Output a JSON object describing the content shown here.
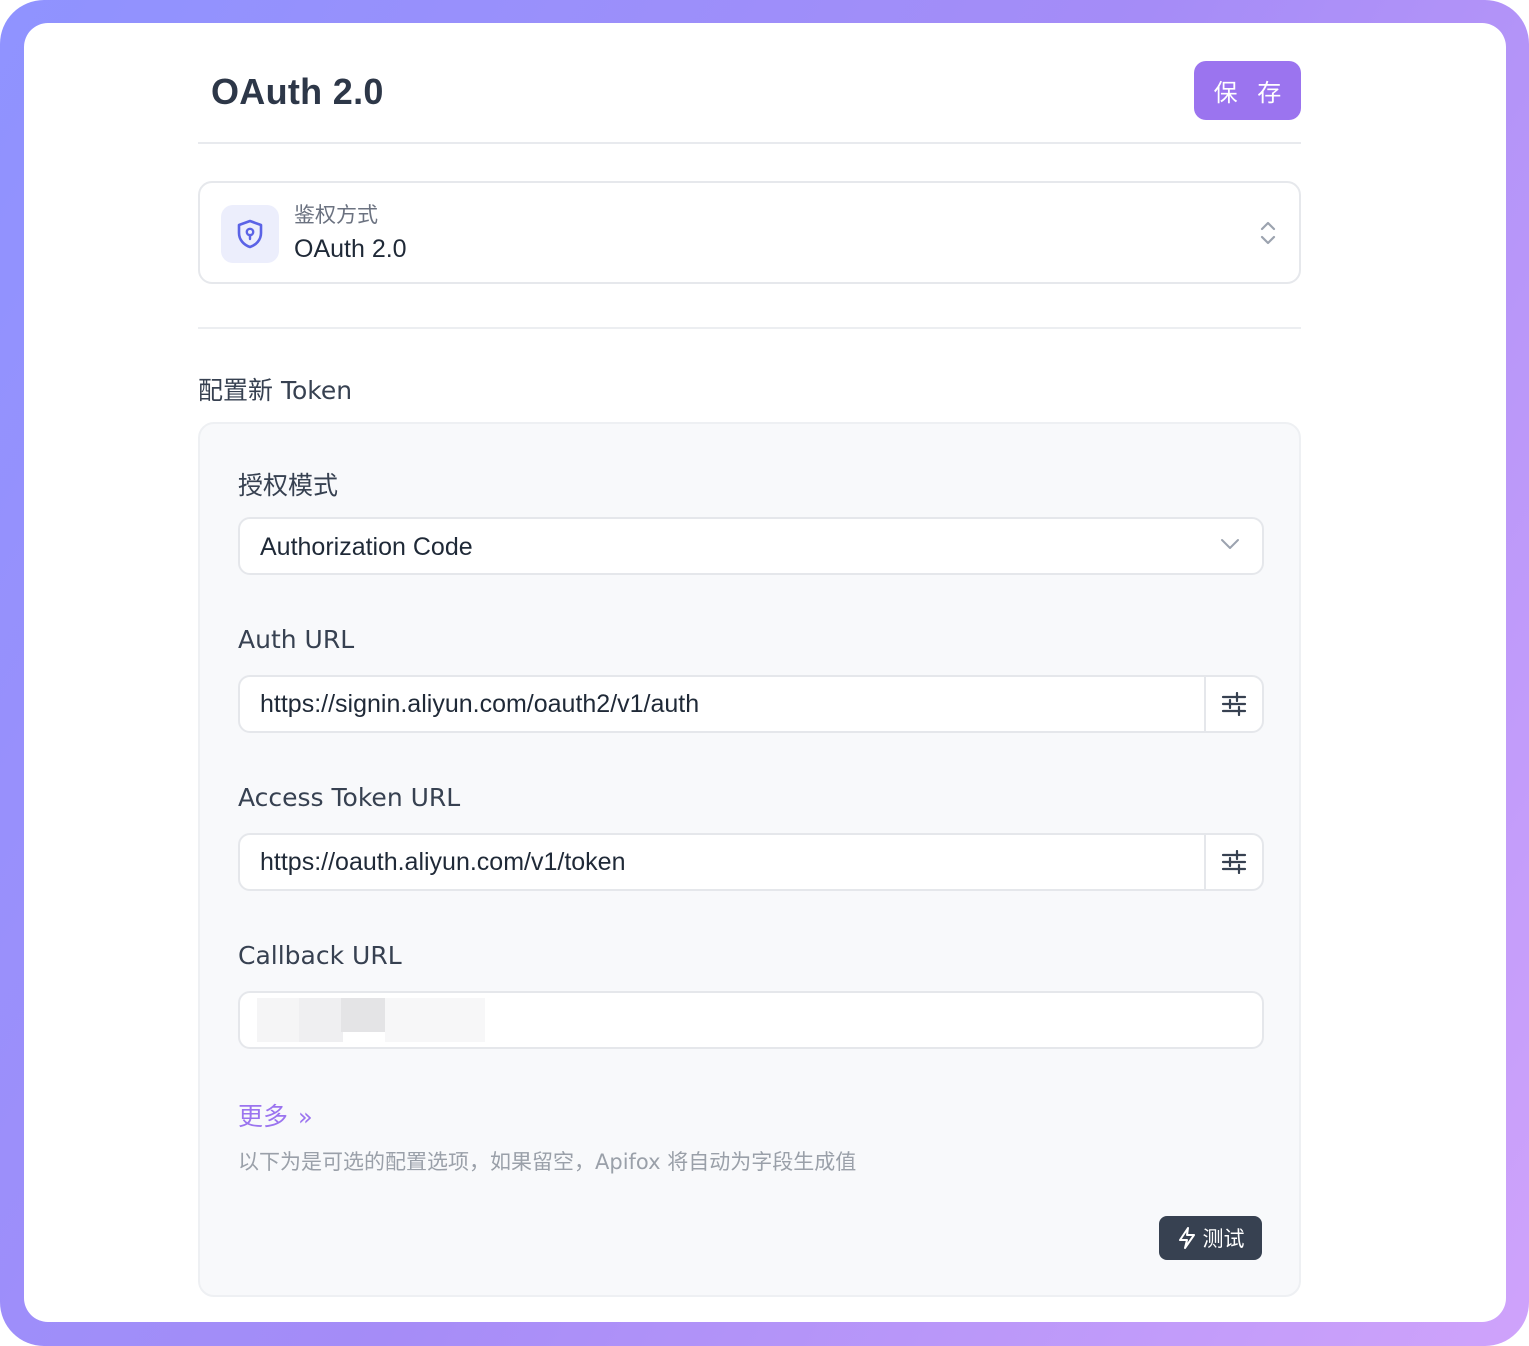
{
  "header": {
    "title": "OAuth 2.0",
    "save_label": "保 存"
  },
  "auth_method": {
    "label": "鉴权方式",
    "value": "OAuth 2.0"
  },
  "token_section": {
    "title": "配置新 Token",
    "grant_type": {
      "label": "授权模式",
      "value": "Authorization Code"
    },
    "auth_url": {
      "label": "Auth URL",
      "value": "https://signin.aliyun.com/oauth2/v1/auth"
    },
    "access_token_url": {
      "label": "Access Token URL",
      "value": "https://oauth.aliyun.com/v1/token"
    },
    "callback_url": {
      "label": "Callback URL",
      "value": ""
    },
    "more_label": "更多",
    "more_arrow": "»",
    "hint": "以下为是可选的配置选项，如果留空，Apifox 将自动为字段生成值",
    "test_label": "测试"
  },
  "colors": {
    "accent": "#9b74ef",
    "dark_button": "#374151"
  },
  "icons": [
    "shield-icon",
    "updown-chevron-icon",
    "chevron-down-icon",
    "sliders-icon",
    "lightning-icon"
  ]
}
